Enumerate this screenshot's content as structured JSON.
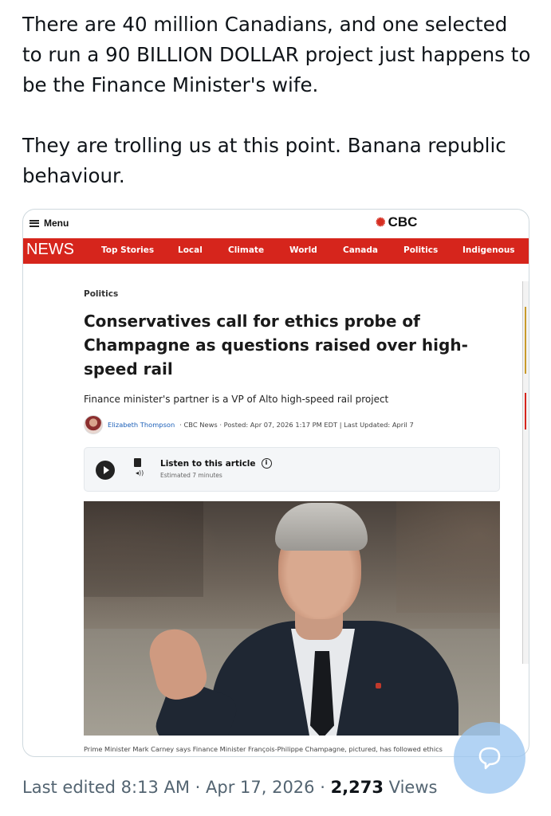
{
  "tweet": {
    "paragraph1": "There are 40 million Canadians, and one selected to run a 90 BILLION DOLLAR project just happens to be the Finance Minister's wife.",
    "paragraph2": "They are trolling us at this point. Banana republic behaviour.",
    "last_edited": "Last edited 8:13 AM · Apr 17, 2026 · ",
    "views_count": "2,273",
    "views_label": " Views"
  },
  "cbc": {
    "menu_label": "Menu",
    "logo_text": "CBC",
    "nav": {
      "section": "NEWS",
      "items": [
        "Top Stories",
        "Local",
        "Climate",
        "World",
        "Canada",
        "Politics",
        "Indigenous"
      ]
    },
    "article": {
      "category": "Politics",
      "headline": "Conservatives call for ethics probe of Champagne as questions raised over high-speed rail",
      "deck": "Finance minister's partner is a VP of Alto high-speed rail project",
      "byline_author": "Elizabeth Thompson",
      "byline_rest": "· CBC News · Posted: Apr 07, 2026 1:17 PM EDT | Last Updated: April 7",
      "listen_title": "Listen to this article",
      "listen_duration": "Estimated 7 minutes",
      "photo_caption": "Prime Minister Mark Carney says Finance Minister François-Philippe Champagne, pictured, has followed ethics"
    }
  },
  "colors": {
    "cbc_red": "#d6251c",
    "link_blue": "#1b5fb8",
    "meta_gray": "#536471",
    "fab_blue": "#98c4f0"
  },
  "icons": {
    "menu": "hamburger-icon",
    "logo": "cbc-gem-icon",
    "play": "play-icon",
    "audio": "audio-article-icon",
    "info": "info-icon",
    "fab": "compose-reply-icon"
  }
}
